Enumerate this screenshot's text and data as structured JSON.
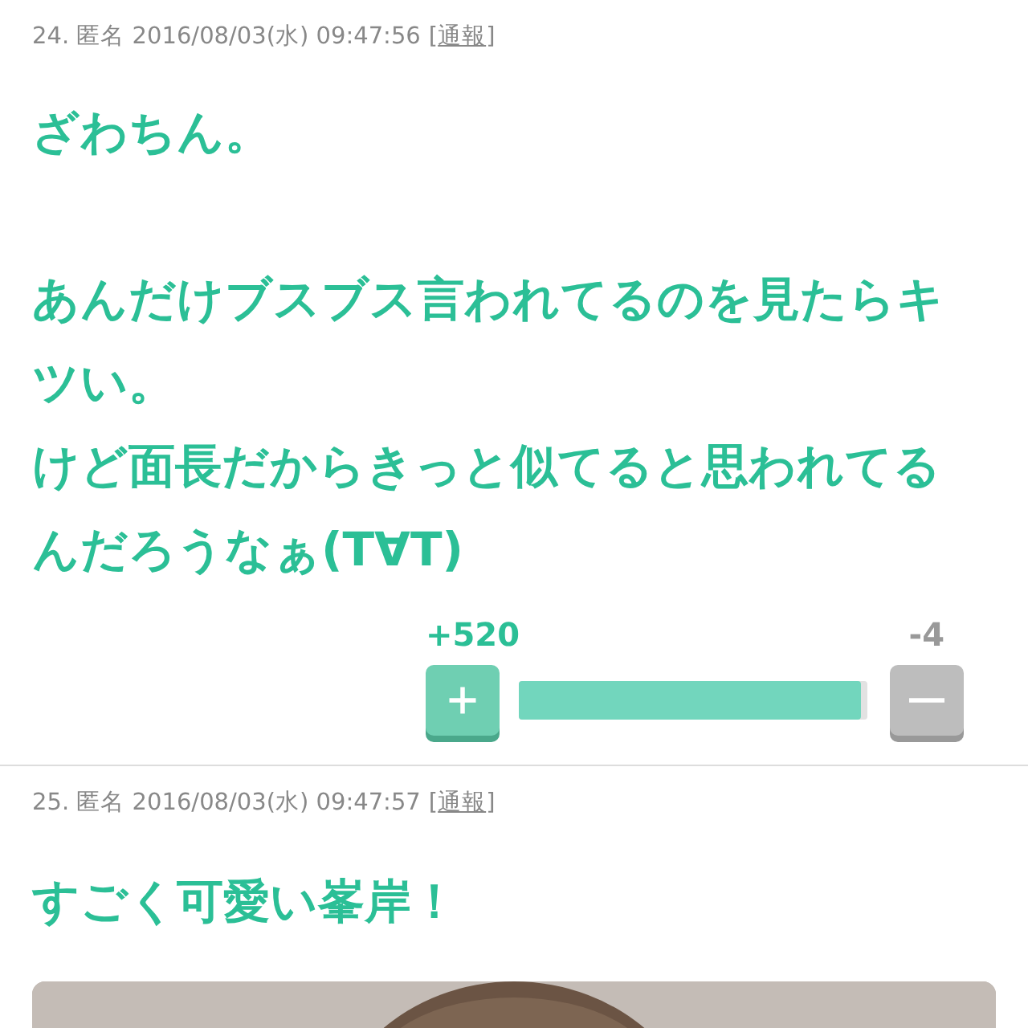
{
  "comments": [
    {
      "header": "24. 匿名 2016/08/03(水) 09:47:56",
      "brackets": [
        "[",
        "]"
      ],
      "report": "通報",
      "blocks": [
        [
          "ざわちん。"
        ],
        [
          "あんだけブスブス言われてるのを見たらキツい。",
          "けど面長だからきっと似てると思われてるんだろうなぁ(T∀T)"
        ]
      ],
      "votes": {
        "plus": "+520",
        "minus": "-4",
        "level": 0.98
      }
    },
    {
      "header": "25. 匿名 2016/08/03(水) 09:47:57",
      "brackets": [
        "[",
        "]"
      ],
      "report": "通報",
      "blocks": [
        [
          "すごく可愛い峯岸！"
        ]
      ],
      "image": {
        "kind": "picture"
      }
    }
  ]
}
